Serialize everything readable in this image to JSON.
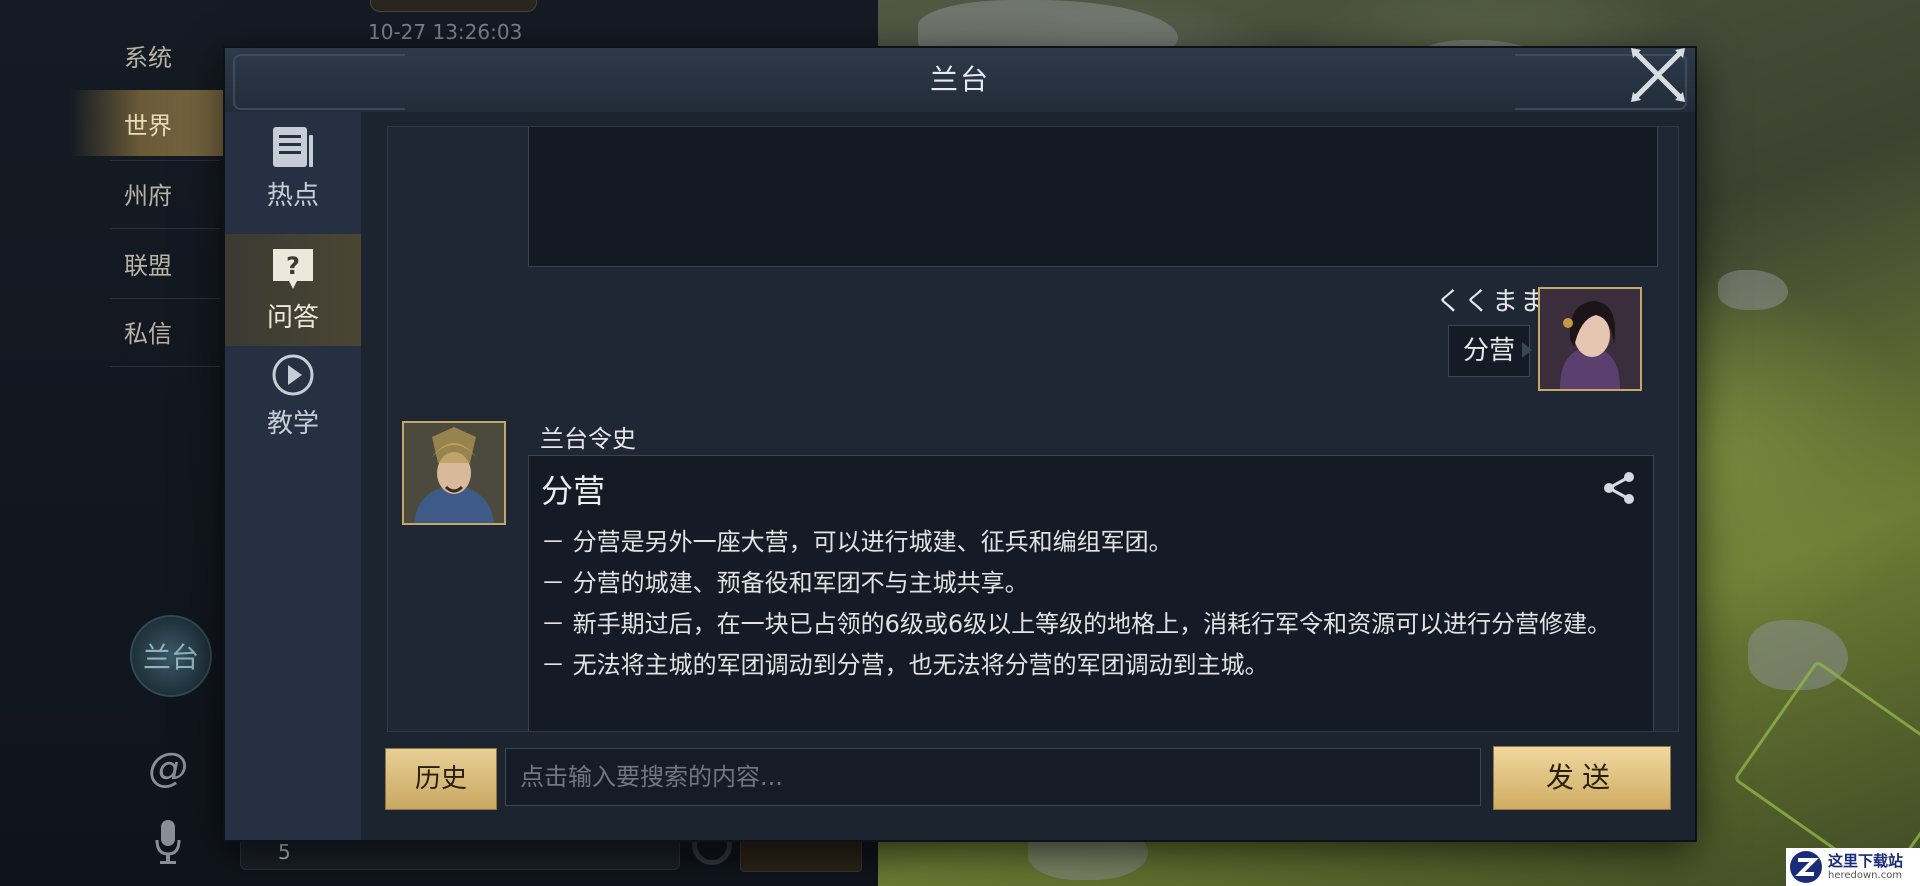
{
  "background": {
    "sidebar_tabs": [
      {
        "label": "系统",
        "active": false
      },
      {
        "label": "世界",
        "active": true
      },
      {
        "label": "州府",
        "active": false
      },
      {
        "label": "联盟",
        "active": false
      },
      {
        "label": "私信",
        "active": false
      }
    ],
    "timestamp": "10-27 13:26:03",
    "emblem_label": "兰台",
    "at_symbol": "@",
    "counter": "5"
  },
  "dialog": {
    "title": "兰台",
    "nav": [
      {
        "label": "热点",
        "icon": "document-icon",
        "active": false
      },
      {
        "label": "问答",
        "icon": "question-icon",
        "active": true
      },
      {
        "label": "教学",
        "icon": "play-icon",
        "active": false
      }
    ],
    "user_message": {
      "name": "くくまま",
      "text": "分营"
    },
    "bot_message": {
      "name": "兰台令史",
      "title": "分营",
      "lines": [
        "－ 分营是另外一座大营，可以进行城建、征兵和编组军团。",
        "－ 分营的城建、预备役和军团不与主城共享。",
        "－ 新手期过后，在一块已占领的6级或6级以上等级的地格上，消耗行军令和资源可以进行分营修建。",
        "－ 无法将主城的军团调动到分营，也无法将分营的军团调动到主城。"
      ]
    },
    "input": {
      "history_label": "历史",
      "placeholder": "点击输入要搜索的内容...",
      "value": "",
      "send_label": "发送"
    }
  },
  "watermark": {
    "main": "这里下载站",
    "sub": "heredown.com"
  },
  "colors": {
    "gold_button": "#d9bd7a",
    "dialog_bg": "#1a222d",
    "nav_bg": "#253142",
    "avatar_border": "#c4a86a"
  }
}
